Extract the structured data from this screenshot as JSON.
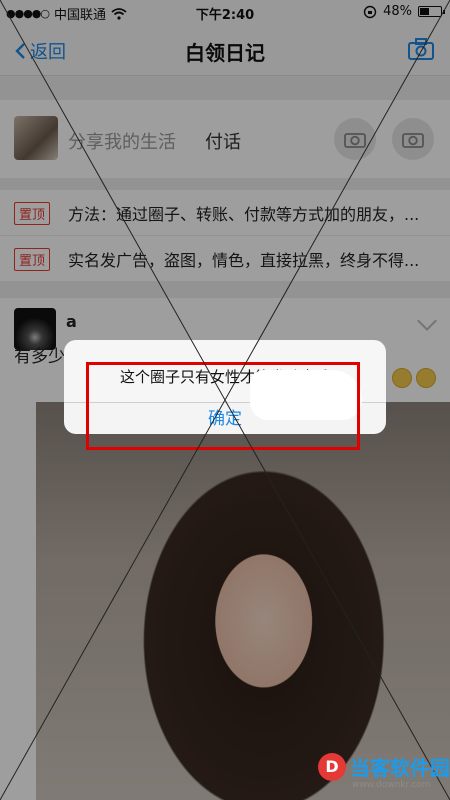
{
  "status_bar": {
    "carrier": "中国联通",
    "time": "下午2:40",
    "battery": "48%",
    "battery_level": 0.48
  },
  "nav": {
    "back_label": "返回",
    "title": "白领日记"
  },
  "share": {
    "placeholder": "分享我的生活",
    "text": "付话"
  },
  "pinned": [
    {
      "badge": "置顶",
      "text": "方法：通过圈子、转账、付款等方式加的朋友，..."
    },
    {
      "badge": "置顶",
      "text": "实名发广告，盗图，情色，直接拉黑，终身不得..."
    }
  ],
  "post": {
    "name": "a",
    "text": "有多少"
  },
  "alert": {
    "message": "这个圈子只有女性才能发动态哦",
    "ok_label": "确定"
  },
  "watermark": {
    "text": "当客软件园",
    "sub": "www.downkr.com"
  },
  "colors": {
    "accent": "#1e88e5",
    "pin_red": "#e53935",
    "highlight": "#e00000"
  },
  "icons": [
    "wifi-icon",
    "chevron-left-icon",
    "camera-icon",
    "chevron-down-icon"
  ]
}
